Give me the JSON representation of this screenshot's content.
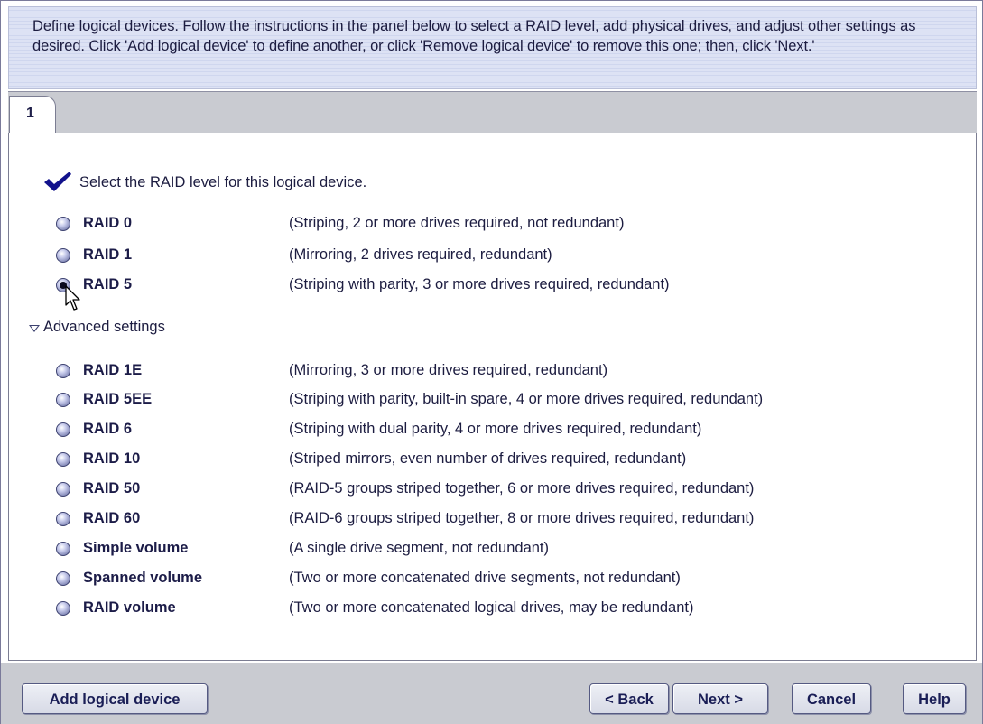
{
  "instructions": "Define logical devices.  Follow the instructions in the panel below to select a RAID level, add physical drives, and adjust other settings as desired.  Click 'Add logical device' to define another, or click 'Remove logical device' to remove this one; then, click 'Next.'",
  "tabs": [
    {
      "label": "1",
      "active": true
    }
  ],
  "prompt": "Select the RAID level for this logical device.",
  "advanced_toggle": {
    "label": "Advanced settings",
    "expanded": true
  },
  "raid_options": [
    {
      "label": "RAID 0",
      "description": "(Striping, 2 or more drives required, not redundant)",
      "selected": false
    },
    {
      "label": "RAID 1",
      "description": "(Mirroring, 2 drives required, redundant)",
      "selected": false
    },
    {
      "label": "RAID 5",
      "description": "(Striping with parity, 3 or more drives required, redundant)",
      "selected": true
    }
  ],
  "advanced_options": [
    {
      "label": "RAID 1E",
      "description": "(Mirroring, 3 or more drives required, redundant)",
      "selected": false
    },
    {
      "label": "RAID 5EE",
      "description": "(Striping with parity, built-in spare, 4 or more drives required, redundant)",
      "selected": false
    },
    {
      "label": "RAID 6",
      "description": "(Striping with dual parity, 4 or more drives required, redundant)",
      "selected": false
    },
    {
      "label": "RAID 10",
      "description": "(Striped mirrors, even number of drives required, redundant)",
      "selected": false
    },
    {
      "label": "RAID 50",
      "description": "(RAID-5 groups striped together, 6 or more drives required, redundant)",
      "selected": false
    },
    {
      "label": "RAID 60",
      "description": "(RAID-6 groups striped together, 8 or more drives required, redundant)",
      "selected": false
    },
    {
      "label": "Simple volume",
      "description": "(A single drive segment, not redundant)",
      "selected": false
    },
    {
      "label": "Spanned volume",
      "description": "(Two or more concatenated drive segments, not redundant)",
      "selected": false
    },
    {
      "label": "RAID volume",
      "description": "(Two or more concatenated logical drives, may be redundant)",
      "selected": false
    }
  ],
  "buttons": {
    "add_logical_device": "Add logical device",
    "back": "< Back",
    "next": "Next >",
    "cancel": "Cancel",
    "help": "Help"
  },
  "colors": {
    "instruction_bg": "#dde2f4",
    "footer_bg": "#c9cbd1",
    "button_text": "#1a1e56",
    "check_blue": "#12128c"
  }
}
